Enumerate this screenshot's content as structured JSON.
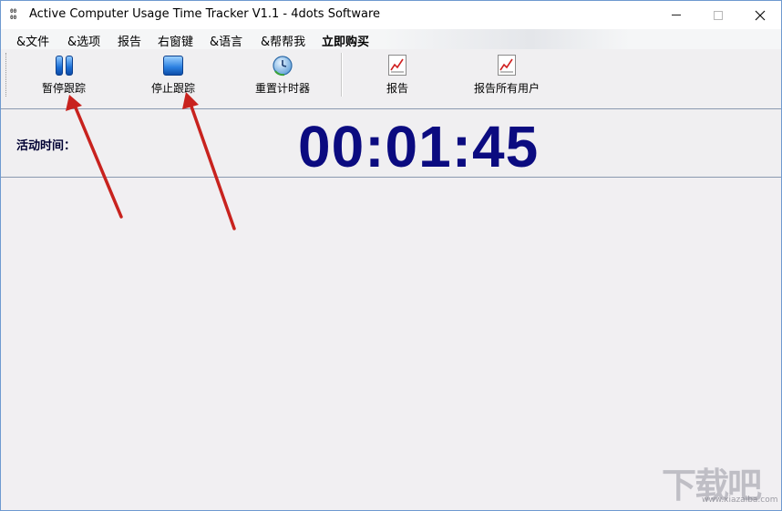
{
  "window": {
    "title": "Active Computer Usage Time Tracker V1.1 - 4dots Software",
    "app_icon_text": "00 00"
  },
  "menu": [
    {
      "label": "&文件"
    },
    {
      "label": "&选项"
    },
    {
      "label": "报告"
    },
    {
      "label": "右窗键"
    },
    {
      "label": "&语言"
    },
    {
      "label": "&帮帮我"
    },
    {
      "label": "立即购买",
      "bold": true
    }
  ],
  "toolbar": {
    "pause_label": "暂停跟踪",
    "stop_label": "停止跟踪",
    "reset_label": "重置计时器",
    "report_label": "报告",
    "report_all_label": "报告所有用户"
  },
  "timer": {
    "label": "活动时间：",
    "value": "00:01:45",
    "color": "#0b0b80"
  },
  "watermark": {
    "text": "下载吧",
    "url": "www.xiazaiba.com"
  },
  "colors": {
    "arrow": "#c8221e",
    "timer_text": "#0b0b80",
    "window_bg": "#f0eff1"
  }
}
